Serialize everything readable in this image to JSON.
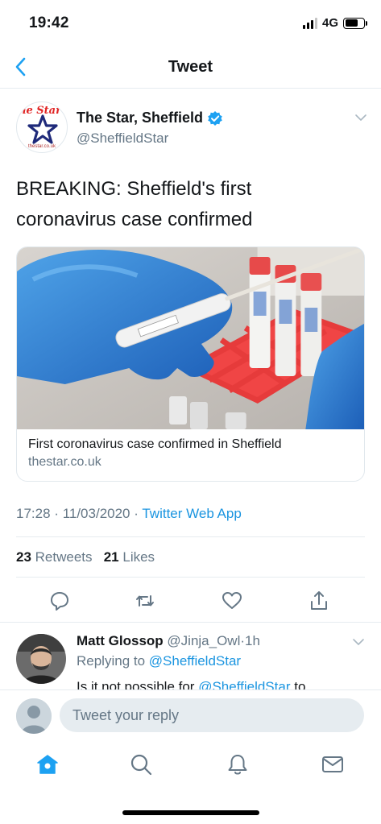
{
  "status_bar": {
    "time": "19:42",
    "network": "4G"
  },
  "nav": {
    "title": "Tweet"
  },
  "tweet": {
    "avatar_logo_text": "ne Star",
    "avatar_logo_sub": "thestar.co.uk",
    "display_name": "The Star, Sheffield",
    "handle": "@SheffieldStar",
    "text_line1": "BREAKING: Sheffield's first",
    "text_line2": "coronavirus case confirmed",
    "card": {
      "title": "First coronavirus case confirmed in Sheffield",
      "domain": "thestar.co.uk"
    },
    "time": "17:28",
    "date": "11/03/2020",
    "source": "Twitter Web App",
    "retweets_count": "23",
    "retweets_label": "Retweets",
    "likes_count": "21",
    "likes_label": "Likes"
  },
  "reply": {
    "name": "Matt Glossop",
    "handle": "@Jinja_Owl",
    "time": "1h",
    "replying_prefix": "Replying to",
    "replying_to": "@SheffieldStar",
    "text_start": "Is it not possible for",
    "text_mention": "@SheffieldStar",
    "text_end": "to"
  },
  "compose": {
    "placeholder": "Tweet your reply"
  },
  "colors": {
    "accent": "#1da1f2",
    "link": "#1b95e0",
    "secondary_text": "#657786",
    "divider": "#e6ecf0"
  },
  "icons": [
    "back-chevron-icon",
    "verified-badge-icon",
    "chevron-down-icon",
    "reply-icon",
    "retweet-icon",
    "like-icon",
    "share-icon",
    "home-icon",
    "search-icon",
    "notifications-icon",
    "messages-icon"
  ]
}
